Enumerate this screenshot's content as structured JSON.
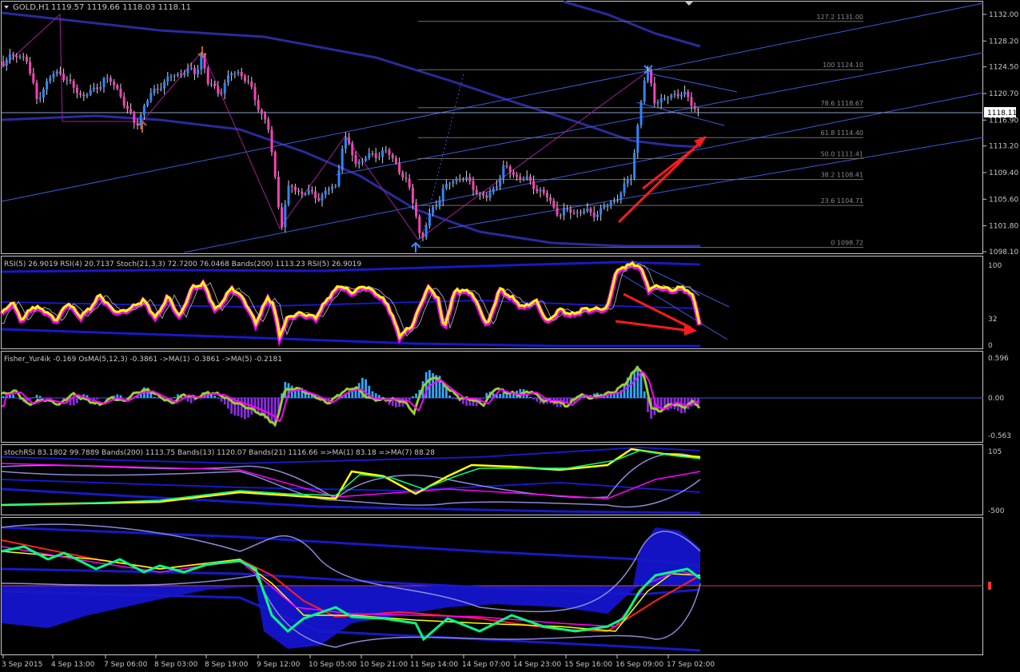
{
  "window": {
    "symbol_label": "GOLD,H1",
    "ohlc": "1119.57 1119.66 1118.03 1118.11",
    "current_price": "1118.11"
  },
  "colors": {
    "background": "#000000",
    "grid_border": "#c8c8c8",
    "bull_candle": "#2e86ff",
    "bear_candle": "#ff3fb6",
    "candle_wick": "#d8d8d8",
    "channel": "#3a5bdc",
    "ma_dark": "#2a2a9c",
    "fibo": "#707070",
    "zigzag": "#a0209a",
    "rsi_main": "#ffff00",
    "rsi_shadow": "#ff00ff",
    "arrow": "#ff1a1a",
    "histo_up": "#2fa8ff",
    "histo_down": "#8a2be2",
    "fisher_green": "#9acd32",
    "stoch_green": "#00ff7f"
  },
  "xaxis": {
    "labels": [
      "3 Sep 2015",
      "4 Sep 13:00",
      "7 Sep 06:00",
      "8 Sep 03:00",
      "8 Sep 19:00",
      "9 Sep 12:00",
      "10 Sep 05:00",
      "10 Sep 21:00",
      "11 Sep 14:00",
      "14 Sep 07:00",
      "14 Sep 23:00",
      "15 Sep 16:00",
      "16 Sep 09:00",
      "17 Sep 02:00"
    ]
  },
  "main_pane": {
    "price_ticks": [
      "1132.00",
      "1128.20",
      "1124.50",
      "1120.70",
      "1116.90",
      "1113.20",
      "1109.40",
      "1105.60",
      "1101.80",
      "1098.10"
    ],
    "fibo_levels": [
      {
        "label": "127.2 1131.00",
        "value": 1131.0
      },
      {
        "label": "100 1124.10",
        "value": 1124.1
      },
      {
        "label": "78.6 1118.67",
        "value": 1118.67
      },
      {
        "label": "61.8 1114.40",
        "value": 1114.4
      },
      {
        "label": "50.0 1111.41",
        "value": 1111.41
      },
      {
        "label": "38.2 1108.41",
        "value": 1108.41
      },
      {
        "label": "23.6 1104.71",
        "value": 1104.71
      },
      {
        "label": "0 1098.72",
        "value": 1098.72
      }
    ]
  },
  "rsi_pane": {
    "header": "RSI(5) 26.9019  RSI(4) 20.7137  Stoch(21,3,3) 72.7200 76.0468  Bands(200) 1113.23  RSI(5) 26.9019",
    "ticks": [
      "100",
      "32",
      "0"
    ]
  },
  "fisher_pane": {
    "header": "Fisher_Yur4ik -0.169  OsMA(5,12,3) -0.3861  ->MA(1) -0.3861  ->MA(5) -0.2181",
    "ticks": [
      "0.596",
      "0.00",
      "-0.563"
    ]
  },
  "stochrsi_pane": {
    "header": "stochRSI 83.1802 99.7889  Bands(200) 1113.75  Bands(13) 1120.07  Bands(21) 1116.66  =>MA(1) 83.18  =>MA(7) 88.28",
    "ticks": [
      "105",
      "-500"
    ]
  },
  "chart_data": [
    {
      "type": "candlestick",
      "title": "GOLD,H1",
      "ylim": [
        1097.3,
        1133.8
      ],
      "y_ticks": [
        1132.0,
        1128.2,
        1124.5,
        1120.7,
        1116.9,
        1113.2,
        1109.4,
        1105.6,
        1101.8,
        1098.1
      ],
      "current_price": 1118.11,
      "close_anchors": [
        [
          0,
          1125.2
        ],
        [
          20,
          1126.0
        ],
        [
          32,
          1126.3
        ],
        [
          38,
          1123.0
        ],
        [
          46,
          1120.0
        ],
        [
          60,
          1122.5
        ],
        [
          75,
          1124.0
        ],
        [
          90,
          1121.5
        ],
        [
          104,
          1120.5
        ],
        [
          118,
          1121.0
        ],
        [
          130,
          1123.0
        ],
        [
          150,
          1121.0
        ],
        [
          160,
          1118.0
        ],
        [
          170,
          1116.0
        ],
        [
          180,
          1119.0
        ],
        [
          200,
          1122.0
        ],
        [
          215,
          1123.0
        ],
        [
          230,
          1124.0
        ],
        [
          245,
          1123.5
        ],
        [
          252,
          1126.5
        ],
        [
          260,
          1122.0
        ],
        [
          275,
          1121.0
        ],
        [
          290,
          1123.5
        ],
        [
          300,
          1124.0
        ],
        [
          315,
          1121.0
        ],
        [
          335,
          1116.0
        ],
        [
          345,
          1108.0
        ],
        [
          352,
          1101.8
        ],
        [
          362,
          1107.5
        ],
        [
          380,
          1106.5
        ],
        [
          400,
          1106.0
        ],
        [
          420,
          1107.5
        ],
        [
          430,
          1114.5
        ],
        [
          445,
          1111.0
        ],
        [
          460,
          1111.5
        ],
        [
          480,
          1112.5
        ],
        [
          495,
          1111.0
        ],
        [
          510,
          1107.5
        ],
        [
          520,
          1104.0
        ],
        [
          527,
          1099.5
        ],
        [
          540,
          1104.0
        ],
        [
          555,
          1107.0
        ],
        [
          575,
          1109.0
        ],
        [
          595,
          1107.0
        ],
        [
          610,
          1105.5
        ],
        [
          630,
          1110.0
        ],
        [
          655,
          1108.5
        ],
        [
          675,
          1107.0
        ],
        [
          700,
          1103.5
        ],
        [
          720,
          1104.0
        ],
        [
          740,
          1103.5
        ],
        [
          760,
          1104.5
        ],
        [
          780,
          1107.0
        ],
        [
          790,
          1109.0
        ],
        [
          795,
          1114.0
        ],
        [
          800,
          1118.0
        ],
        [
          805,
          1122.0
        ],
        [
          812,
          1123.8
        ],
        [
          818,
          1120.0
        ],
        [
          830,
          1119.5
        ],
        [
          845,
          1121.0
        ],
        [
          860,
          1120.0
        ],
        [
          875,
          1118.1
        ]
      ],
      "xlabel": "",
      "ylabel": ""
    },
    {
      "type": "line",
      "title": "RSI(5) 26.9019",
      "ylim": [
        0,
        100
      ],
      "y_ticks": [
        100,
        32,
        0
      ],
      "last_values": {
        "RSI(5)": 26.9019,
        "RSI(4)": 20.7137,
        "Stoch main": 72.72,
        "Stoch signal": 76.0468
      },
      "rsi_anchors": [
        [
          0,
          36
        ],
        [
          15,
          53
        ],
        [
          28,
          30
        ],
        [
          40,
          47
        ],
        [
          55,
          43
        ],
        [
          70,
          30
        ],
        [
          85,
          52
        ],
        [
          100,
          35
        ],
        [
          112,
          44
        ],
        [
          125,
          61
        ],
        [
          140,
          44
        ],
        [
          150,
          40
        ],
        [
          165,
          46
        ],
        [
          180,
          55
        ],
        [
          195,
          33
        ],
        [
          210,
          60
        ],
        [
          225,
          34
        ],
        [
          240,
          70
        ],
        [
          255,
          75
        ],
        [
          270,
          42
        ],
        [
          290,
          70
        ],
        [
          305,
          56
        ],
        [
          320,
          27
        ],
        [
          335,
          58
        ],
        [
          342,
          50
        ],
        [
          350,
          12
        ],
        [
          360,
          34
        ],
        [
          375,
          39
        ],
        [
          395,
          34
        ],
        [
          410,
          57
        ],
        [
          425,
          73
        ],
        [
          440,
          64
        ],
        [
          455,
          72
        ],
        [
          470,
          64
        ],
        [
          485,
          50
        ],
        [
          500,
          12
        ],
        [
          515,
          23
        ],
        [
          525,
          46
        ],
        [
          535,
          71
        ],
        [
          548,
          58
        ],
        [
          555,
          20
        ],
        [
          570,
          68
        ],
        [
          590,
          64
        ],
        [
          600,
          44
        ],
        [
          610,
          24
        ],
        [
          625,
          69
        ],
        [
          640,
          58
        ],
        [
          655,
          46
        ],
        [
          670,
          55
        ],
        [
          685,
          28
        ],
        [
          700,
          44
        ],
        [
          715,
          37
        ],
        [
          730,
          44
        ],
        [
          745,
          44
        ],
        [
          760,
          45
        ],
        [
          770,
          88
        ],
        [
          785,
          98
        ],
        [
          800,
          97
        ],
        [
          812,
          69
        ],
        [
          825,
          72
        ],
        [
          840,
          67
        ],
        [
          855,
          71
        ],
        [
          868,
          58
        ],
        [
          875,
          27
        ]
      ]
    },
    {
      "type": "bar",
      "title": "Fisher_Yur4ik -0.169",
      "ylim": [
        -0.563,
        0.596
      ],
      "y_ticks": [
        0.596,
        0.0,
        -0.563
      ],
      "last_values": {
        "Fisher_Yur4ik": -0.169,
        "OsMA(5,12,3)": -0.3861,
        "MA(1)": -0.3861,
        "MA(5)": -0.2181
      },
      "osma_anchors": [
        [
          0,
          0.05
        ],
        [
          15,
          0.08
        ],
        [
          30,
          -0.1
        ],
        [
          45,
          0.02
        ],
        [
          60,
          -0.05
        ],
        [
          75,
          0.03
        ],
        [
          90,
          -0.12
        ],
        [
          105,
          0.05
        ],
        [
          120,
          -0.05
        ],
        [
          135,
          -0.02
        ],
        [
          150,
          0.05
        ],
        [
          165,
          -0.03
        ],
        [
          180,
          0.18
        ],
        [
          195,
          0.0
        ],
        [
          210,
          -0.06
        ],
        [
          225,
          0.04
        ],
        [
          240,
          -0.08
        ],
        [
          255,
          0.1
        ],
        [
          270,
          0.05
        ],
        [
          290,
          -0.25
        ],
        [
          305,
          -0.35
        ],
        [
          320,
          -0.2
        ],
        [
          335,
          -0.3
        ],
        [
          345,
          -0.4
        ],
        [
          355,
          0.25
        ],
        [
          370,
          0.15
        ],
        [
          390,
          0.05
        ],
        [
          410,
          -0.06
        ],
        [
          425,
          0.06
        ],
        [
          440,
          0.12
        ],
        [
          455,
          0.3
        ],
        [
          465,
          0.1
        ],
        [
          480,
          -0.05
        ],
        [
          495,
          -0.15
        ],
        [
          510,
          -0.05
        ],
        [
          525,
          0.15
        ],
        [
          535,
          0.42
        ],
        [
          550,
          0.3
        ],
        [
          565,
          -0.02
        ],
        [
          580,
          -0.08
        ],
        [
          595,
          -0.12
        ],
        [
          610,
          0.1
        ],
        [
          625,
          0.05
        ],
        [
          640,
          0.05
        ],
        [
          655,
          0.12
        ],
        [
          670,
          -0.05
        ],
        [
          685,
          -0.06
        ],
        [
          700,
          -0.12
        ],
        [
          715,
          -0.1
        ],
        [
          730,
          0.02
        ],
        [
          745,
          0.06
        ],
        [
          760,
          0.08
        ],
        [
          775,
          0.12
        ],
        [
          790,
          0.38
        ],
        [
          800,
          0.5
        ],
        [
          812,
          -0.35
        ],
        [
          825,
          -0.2
        ],
        [
          840,
          -0.15
        ],
        [
          855,
          -0.2
        ],
        [
          868,
          -0.1
        ],
        [
          875,
          -0.12
        ]
      ],
      "fisher_anchors": [
        [
          0,
          0.05
        ],
        [
          20,
          0.1
        ],
        [
          35,
          -0.1
        ],
        [
          55,
          -0.02
        ],
        [
          75,
          -0.1
        ],
        [
          90,
          0.06
        ],
        [
          110,
          -0.04
        ],
        [
          125,
          -0.1
        ],
        [
          140,
          0.0
        ],
        [
          155,
          -0.05
        ],
        [
          170,
          0.08
        ],
        [
          185,
          0.12
        ],
        [
          200,
          0.02
        ],
        [
          215,
          -0.08
        ],
        [
          230,
          0.05
        ],
        [
          245,
          0.0
        ],
        [
          260,
          0.08
        ],
        [
          275,
          0.05
        ],
        [
          290,
          -0.05
        ],
        [
          305,
          -0.12
        ],
        [
          320,
          -0.2
        ],
        [
          335,
          -0.3
        ],
        [
          345,
          -0.42
        ],
        [
          355,
          0.1
        ],
        [
          370,
          0.15
        ],
        [
          390,
          0.05
        ],
        [
          410,
          -0.08
        ],
        [
          430,
          0.1
        ],
        [
          445,
          0.16
        ],
        [
          460,
          0.0
        ],
        [
          475,
          -0.03
        ],
        [
          490,
          -0.02
        ],
        [
          505,
          -0.05
        ],
        [
          518,
          -0.22
        ],
        [
          530,
          0.2
        ],
        [
          545,
          0.32
        ],
        [
          560,
          0.15
        ],
        [
          575,
          0.0
        ],
        [
          590,
          -0.02
        ],
        [
          605,
          -0.1
        ],
        [
          620,
          0.15
        ],
        [
          635,
          0.08
        ],
        [
          650,
          0.05
        ],
        [
          665,
          0.1
        ],
        [
          680,
          -0.04
        ],
        [
          695,
          -0.05
        ],
        [
          710,
          -0.12
        ],
        [
          725,
          0.05
        ],
        [
          740,
          0.0
        ],
        [
          755,
          0.05
        ],
        [
          770,
          0.1
        ],
        [
          785,
          0.25
        ],
        [
          798,
          0.48
        ],
        [
          806,
          0.3
        ],
        [
          815,
          -0.15
        ],
        [
          825,
          -0.2
        ],
        [
          840,
          -0.08
        ],
        [
          855,
          -0.14
        ],
        [
          868,
          -0.05
        ],
        [
          875,
          -0.14
        ]
      ]
    },
    {
      "type": "line",
      "title": "stochRSI 83.1802 99.7889",
      "y_ticks": [
        105,
        -500
      ],
      "last_values": {
        "stochRSI main": 83.1802,
        "stochRSI signal": 99.7889,
        "Bands(200)": 1113.75,
        "Bands(13)": 1120.07,
        "Bands(21)": 1116.66,
        "MA(1)": 83.18,
        "MA(7)": 88.28
      }
    }
  ]
}
